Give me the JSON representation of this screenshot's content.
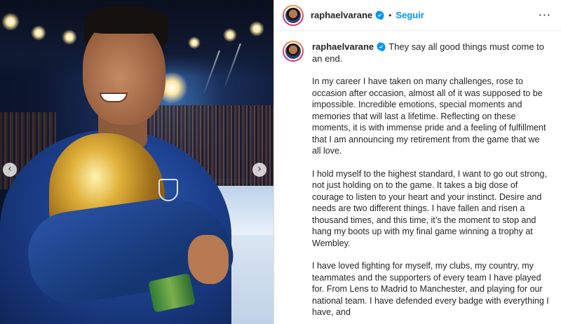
{
  "post": {
    "username": "raphaelvarane",
    "follow_label": "Seguir",
    "separator": "•",
    "more_label": "···",
    "caption_first": "They say all good things must come to an end.",
    "paragraphs": [
      "In my career I have taken on many challenges, rose to occasion after occasion, almost all of it was supposed to be impossible. Incredible emotions, special moments and memories that will last a lifetime. Reflecting on these moments, it is with immense pride and a feeling of fulfillment that I am announcing my retirement from the game that we all love.",
      "I hold myself to the highest standard, I want to go out strong, not just holding on to the game. It takes a big dose of courage to listen to your heart and your instinct. Desire and needs are two different things. I have fallen and risen a thousand times, and this time, it’s the moment to stop and hang my boots up with my final game winning a trophy at Wembley.",
      "I have loved fighting for myself, my clubs, my country, my teammates and the supporters of every team I have played for. From Lens to Madrid to Manchester, and playing for our national team. I have defended every badge with everything I have, and"
    ]
  },
  "media": {
    "prev_label": "‹",
    "next_label": "›"
  },
  "colors": {
    "follow": "#0095f6",
    "verified": "#0095f6",
    "border": "#dbdbdb"
  },
  "icons": [
    "verified-badge-icon",
    "more-options-icon",
    "chevron-left-icon",
    "chevron-right-icon"
  ]
}
